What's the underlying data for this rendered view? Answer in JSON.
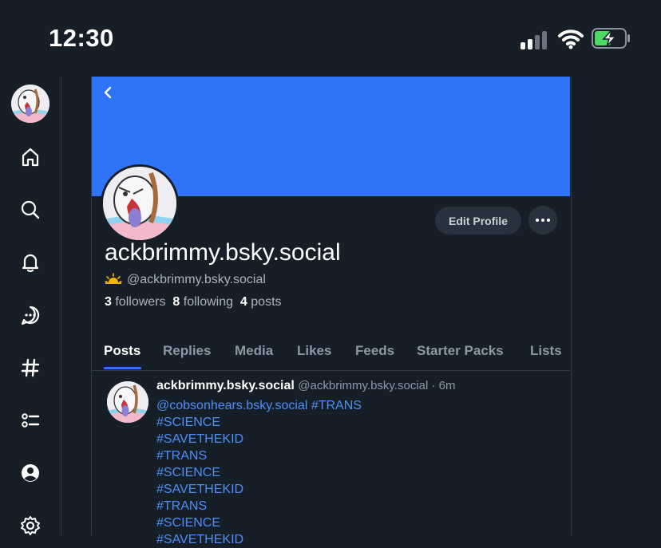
{
  "status_bar": {
    "time": "12:30"
  },
  "sidebar": {
    "items": [
      {
        "name": "home"
      },
      {
        "name": "search"
      },
      {
        "name": "notifications"
      },
      {
        "name": "chat"
      },
      {
        "name": "feeds"
      },
      {
        "name": "lists"
      },
      {
        "name": "profile"
      },
      {
        "name": "settings"
      }
    ]
  },
  "profile": {
    "display_name": "ackbrimmy.bsky.social",
    "handle": "@ackbrimmy.bsky.social",
    "handle_emoji": "sunrise-icon",
    "followers_count": "3",
    "followers_label": "followers",
    "following_count": "8",
    "following_label": "following",
    "posts_count": "4",
    "posts_label": "posts",
    "edit_label": "Edit Profile",
    "banner_color": "#2f74f6"
  },
  "tabs": [
    {
      "label": "Posts",
      "active": true
    },
    {
      "label": "Replies"
    },
    {
      "label": "Media"
    },
    {
      "label": "Likes"
    },
    {
      "label": "Feeds"
    },
    {
      "label": "Starter Packs"
    },
    {
      "label": "Lists"
    }
  ],
  "post": {
    "author": "ackbrimmy.bsky.social",
    "meta": "@ackbrimmy.bsky.social · 6m",
    "lines": [
      "@cobsonhears.bsky.social #TRANS",
      "#SCIENCE",
      "#SAVETHEKID",
      "#TRANS",
      "#SCIENCE",
      "#SAVETHEKID",
      "#TRANS",
      "#SCIENCE",
      "#SAVETHEKID"
    ]
  },
  "colors": {
    "accent": "#2f74f6",
    "background": "#161e27",
    "link": "#4d8ff8"
  }
}
